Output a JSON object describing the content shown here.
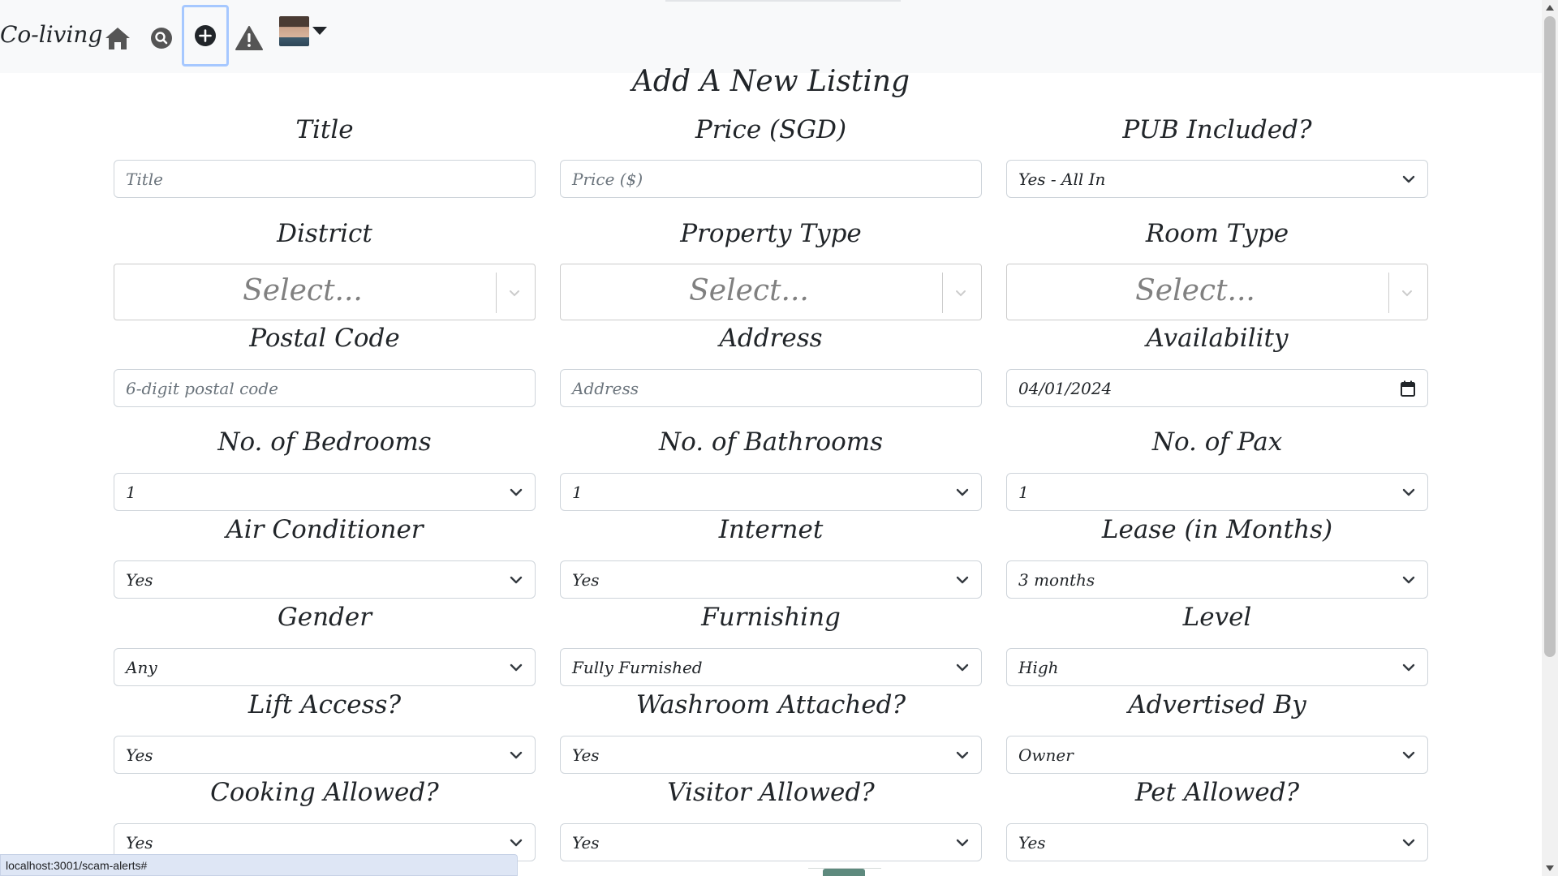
{
  "navbar": {
    "brand": "Co-living",
    "icons": [
      "home-icon",
      "search-icon",
      "plus-circle-icon",
      "warning-icon",
      "avatar"
    ]
  },
  "form": {
    "heading": "Add A New Listing",
    "rows": [
      [
        {
          "label": "Title",
          "kind": "text",
          "placeholder": "Title"
        },
        {
          "label": "Price (SGD)",
          "kind": "text",
          "placeholder": "Price ($)"
        },
        {
          "label": "PUB Included?",
          "kind": "select",
          "value": "Yes - All In"
        }
      ],
      [
        {
          "label": "District",
          "kind": "react-select",
          "placeholder": "Select..."
        },
        {
          "label": "Property Type",
          "kind": "react-select",
          "placeholder": "Select..."
        },
        {
          "label": "Room Type",
          "kind": "react-select",
          "placeholder": "Select..."
        }
      ],
      [
        {
          "label": "Postal Code",
          "kind": "text",
          "placeholder": "6-digit postal code"
        },
        {
          "label": "Address",
          "kind": "text",
          "placeholder": "Address"
        },
        {
          "label": "Availability",
          "kind": "date",
          "value": "04/01/2024"
        }
      ],
      [
        {
          "label": "No. of Bedrooms",
          "kind": "select",
          "value": "1"
        },
        {
          "label": "No. of Bathrooms",
          "kind": "select",
          "value": "1"
        },
        {
          "label": "No. of Pax",
          "kind": "select",
          "value": "1"
        }
      ],
      [
        {
          "label": "Air Conditioner",
          "kind": "select",
          "value": "Yes"
        },
        {
          "label": "Internet",
          "kind": "select",
          "value": "Yes"
        },
        {
          "label": "Lease (in Months)",
          "kind": "select",
          "value": "3 months"
        }
      ],
      [
        {
          "label": "Gender",
          "kind": "select",
          "value": "Any"
        },
        {
          "label": "Furnishing",
          "kind": "select",
          "value": "Fully Furnished"
        },
        {
          "label": "Level",
          "kind": "select",
          "value": "High"
        }
      ],
      [
        {
          "label": "Lift Access?",
          "kind": "select",
          "value": "Yes"
        },
        {
          "label": "Washroom Attached?",
          "kind": "select",
          "value": "Yes"
        },
        {
          "label": "Advertised By",
          "kind": "select",
          "value": "Owner"
        }
      ],
      [
        {
          "label": "Cooking Allowed?",
          "kind": "select",
          "value": "Yes"
        },
        {
          "label": "Visitor Allowed?",
          "kind": "select",
          "value": "Yes"
        },
        {
          "label": "Pet Allowed?",
          "kind": "select",
          "value": "Yes"
        }
      ]
    ]
  },
  "status_bar": {
    "url": "localhost:3001/scam-alerts#"
  },
  "colors": {
    "navbar_bg": "#f8f9fa",
    "focus_ring": "#a6c8ff",
    "border": "#ced4da",
    "placeholder": "#6c757d"
  }
}
